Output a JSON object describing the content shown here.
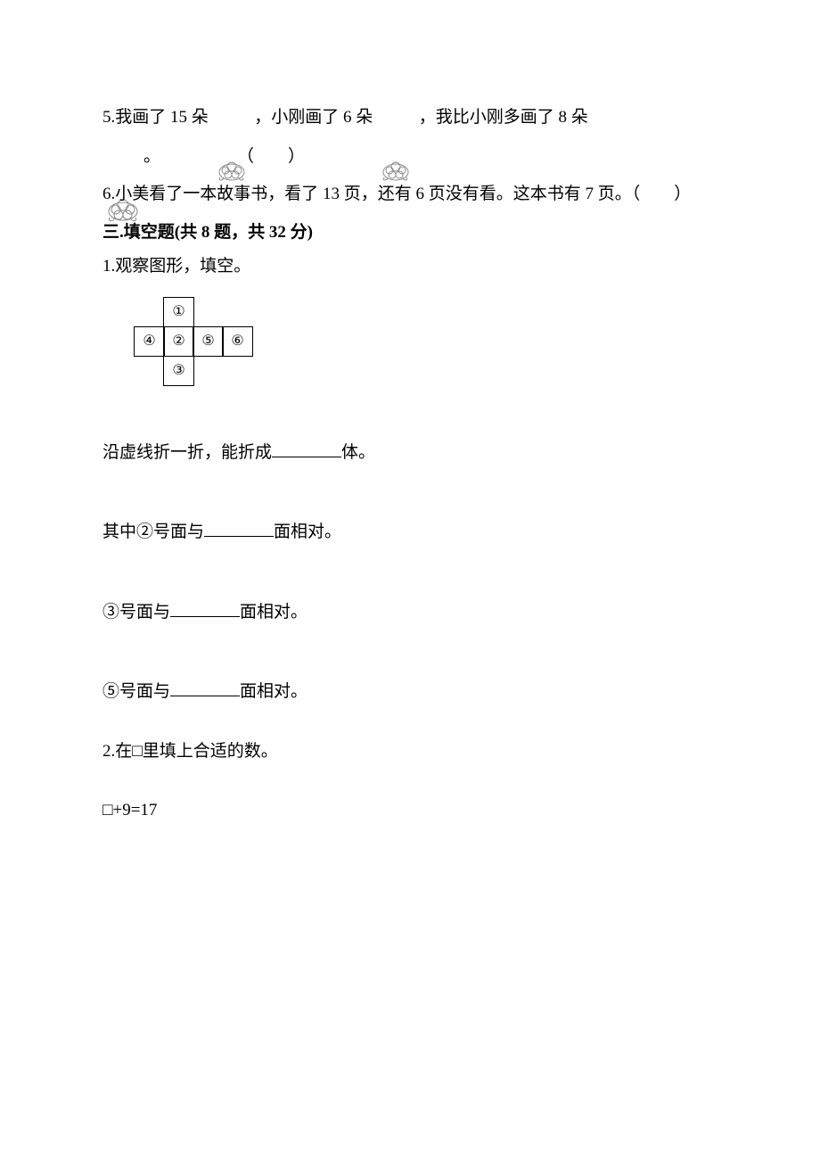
{
  "q5": {
    "part1": "5.我画了 15 朵 ",
    "part2": " ，小刚画了 6 朵 ",
    "part3": " ，我比小刚多画了 8 朵",
    "part4": "。",
    "paren": "（　　）"
  },
  "q6": {
    "text": "6.小美看了一本故事书，看了 13 页，还有 6 页没有看。这本书有 7 页。（　　）"
  },
  "section3": {
    "heading": "三.填空题(共 8 题，共 32 分)"
  },
  "s3q1": {
    "lead": "1.观察图形，填空。",
    "net": {
      "c1": "①",
      "c2": "②",
      "c3": "③",
      "c4": "④",
      "c5": "⑤",
      "c6": "⑥"
    },
    "line_a_pre": "沿虚线折一折，能折成",
    "line_a_post": "体。",
    "line_b_pre": "其中②号面与",
    "line_b_post": "面相对。",
    "line_c_pre": "③号面与",
    "line_c_post": "面相对。",
    "line_d_pre": "⑤号面与",
    "line_d_post": "面相对。"
  },
  "s3q2": {
    "lead": "2.在□里填上合适的数。",
    "expr1": "□+9=17"
  }
}
